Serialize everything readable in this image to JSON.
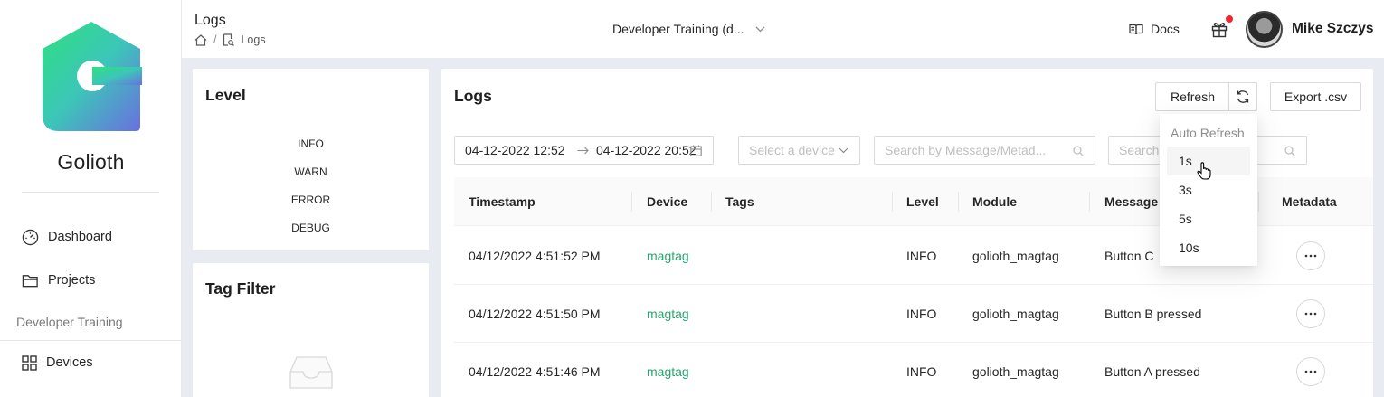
{
  "sidebar": {
    "brand": "Golioth",
    "nav": [
      {
        "label": "Dashboard",
        "icon": "gauge-icon"
      },
      {
        "label": "Projects",
        "icon": "folder-icon"
      }
    ],
    "section": "Developer Training",
    "section_nav": [
      {
        "label": "Devices",
        "icon": "grid-icon"
      }
    ]
  },
  "header": {
    "title": "Logs",
    "breadcrumb": {
      "current": "Logs"
    },
    "project": "Developer Training (d...",
    "docs": "Docs",
    "user": "Mike Szczys"
  },
  "level_card": {
    "title": "Level",
    "levels": [
      "INFO",
      "WARN",
      "ERROR",
      "DEBUG"
    ]
  },
  "tag_card": {
    "title": "Tag Filter"
  },
  "logs": {
    "title": "Logs",
    "refresh_label": "Refresh",
    "export_label": "Export .csv",
    "date_start": "04-12-2022 12:52",
    "date_end": "04-12-2022 20:52",
    "device_placeholder": "Select a device",
    "search_placeholder": "Search by Message/Metad...",
    "search2_placeholder": "Search",
    "columns": [
      "Timestamp",
      "Device",
      "Tags",
      "Level",
      "Module",
      "Message",
      "Metadata"
    ],
    "rows": [
      {
        "timestamp": "04/12/2022 4:51:52 PM",
        "device": "magtag",
        "tags": "",
        "level": "INFO",
        "module": "golioth_magtag",
        "message": "Button C"
      },
      {
        "timestamp": "04/12/2022 4:51:50 PM",
        "device": "magtag",
        "tags": "",
        "level": "INFO",
        "module": "golioth_magtag",
        "message": "Button B pressed"
      },
      {
        "timestamp": "04/12/2022 4:51:46 PM",
        "device": "magtag",
        "tags": "",
        "level": "INFO",
        "module": "golioth_magtag",
        "message": "Button A pressed"
      }
    ]
  },
  "auto_refresh": {
    "title": "Auto Refresh",
    "options": [
      "1s",
      "3s",
      "5s",
      "10s"
    ],
    "hovered": "1s"
  },
  "colors": {
    "accent": "#27a56b",
    "background": "#e8ecf2",
    "notification": "#f5222d"
  }
}
